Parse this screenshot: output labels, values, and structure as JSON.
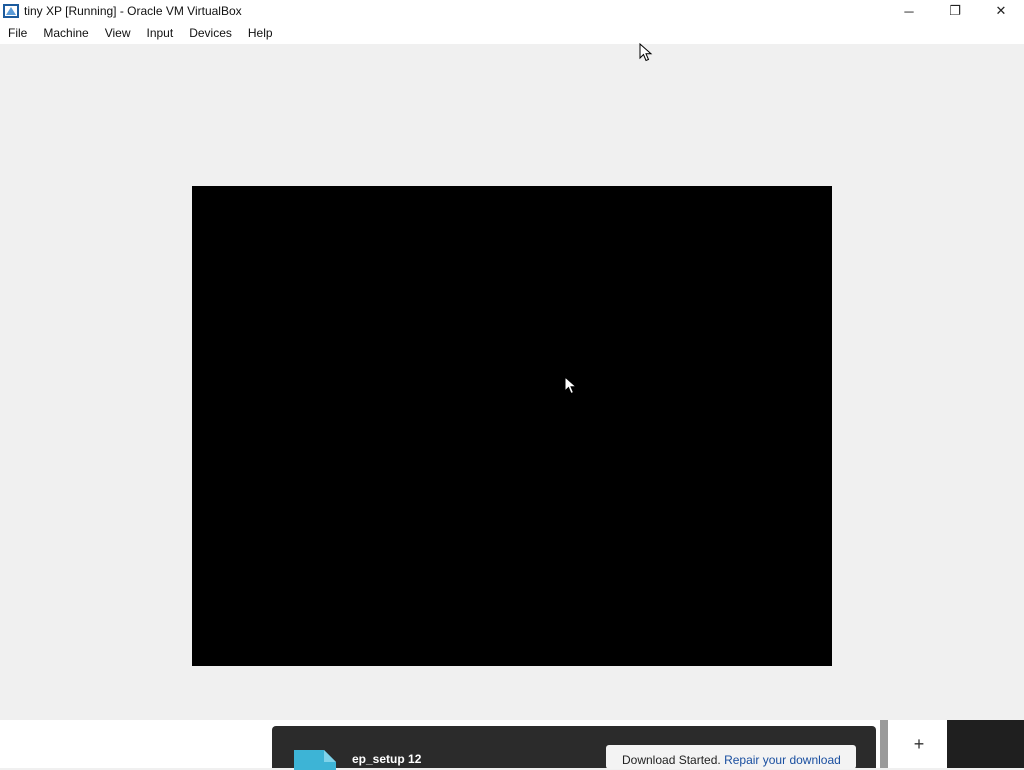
{
  "window": {
    "title": "tiny XP [Running] - Oracle VM VirtualBox",
    "app_icon": "virtualbox-icon",
    "controls": {
      "minimize": "─",
      "restore": "❐",
      "close": "✕"
    }
  },
  "menubar": {
    "items": [
      "File",
      "Machine",
      "View",
      "Input",
      "Devices",
      "Help"
    ]
  },
  "vm_display": {
    "state": "black-screen"
  },
  "download": {
    "file_name": "ep_setup 12",
    "toast_text": "Download Started.",
    "toast_link": "Repair your download"
  },
  "taskbar": {
    "plus_label": "+"
  },
  "colors": {
    "window_bg": "#f0f0f0",
    "vm_screen": "#000000",
    "download_panel": "#2b2b2b",
    "file_icon": "#3db4d6",
    "link": "#1a4fa0"
  }
}
